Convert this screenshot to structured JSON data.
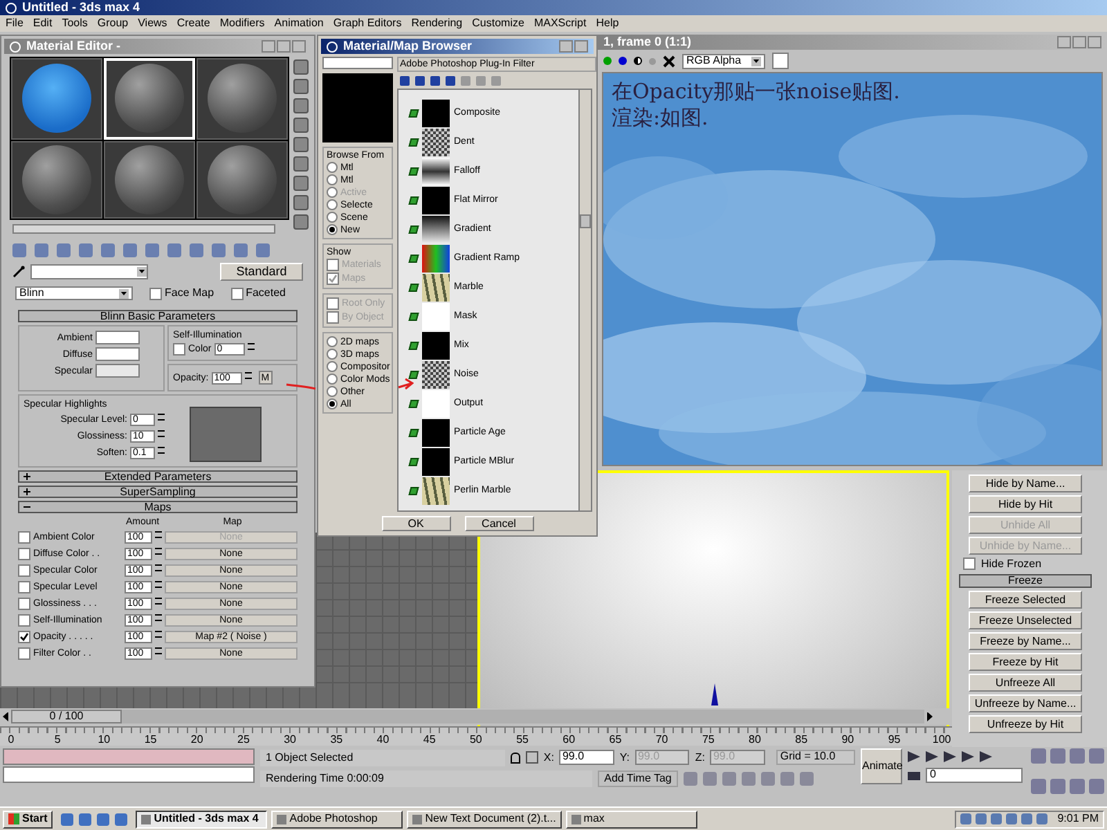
{
  "app": {
    "title": "Untitled - 3ds max 4",
    "menu": [
      "File",
      "Edit",
      "Tools",
      "Group",
      "Views",
      "Create",
      "Modifiers",
      "Animation",
      "Graph Editors",
      "Rendering",
      "Customize",
      "MAXScript",
      "Help"
    ]
  },
  "material_editor": {
    "title": "Material Editor -",
    "slots": [
      {
        "kind": "blue",
        "selected": false
      },
      {
        "kind": "gray",
        "selected": true
      },
      {
        "kind": "gray",
        "selected": false
      },
      {
        "kind": "gray",
        "selected": false
      },
      {
        "kind": "gray",
        "selected": false
      },
      {
        "kind": "gray",
        "selected": false
      }
    ],
    "type_button": "Standard",
    "shader": "Blinn",
    "options": [
      {
        "label": "Face Map",
        "checked": false
      },
      {
        "label": "Faceted",
        "checked": false
      }
    ],
    "basic_rollout": "Blinn Basic Parameters",
    "colors": [
      {
        "label": "Ambient",
        "kind": "white"
      },
      {
        "label": "Diffuse",
        "kind": "white"
      },
      {
        "label": "Specular",
        "kind": "light"
      }
    ],
    "self_illumination": {
      "title": "Self-Illumination",
      "label": "Color",
      "checked": false,
      "value": "0"
    },
    "opacity": {
      "label": "Opacity:",
      "value": "100",
      "button": "M"
    },
    "specular": {
      "title": "Specular Highlights",
      "fields": [
        {
          "label": "Specular Level:",
          "value": "0"
        },
        {
          "label": "Glossiness:",
          "value": "10"
        },
        {
          "label": "Soften:",
          "value": "0.1"
        }
      ]
    },
    "rollouts": [
      {
        "title": "Extended Parameters",
        "expanded": false
      },
      {
        "title": "SuperSampling",
        "expanded": false
      },
      {
        "title": "Maps",
        "expanded": true
      }
    ],
    "maps": {
      "columns": [
        "Amount",
        "Map"
      ],
      "rows": [
        {
          "label": "Ambient Color",
          "checked": false,
          "amount": "100",
          "map": "None",
          "disabled": true
        },
        {
          "label": "Diffuse Color . .",
          "checked": false,
          "amount": "100",
          "map": "None",
          "disabled": false
        },
        {
          "label": "Specular Color",
          "checked": false,
          "amount": "100",
          "map": "None",
          "disabled": false
        },
        {
          "label": "Specular Level",
          "checked": false,
          "amount": "100",
          "map": "None",
          "disabled": false
        },
        {
          "label": "Glossiness . . .",
          "checked": false,
          "amount": "100",
          "map": "None",
          "disabled": false
        },
        {
          "label": "Self-Illumination",
          "checked": false,
          "amount": "100",
          "map": "None",
          "disabled": false
        },
        {
          "label": "Opacity . . . . .",
          "checked": true,
          "amount": "100",
          "map": "Map #2  ( Noise )",
          "disabled": false
        },
        {
          "label": "Filter Color . .",
          "checked": false,
          "amount": "100",
          "map": "None",
          "disabled": false
        }
      ]
    }
  },
  "browser": {
    "title": "Material/Map Browser",
    "filter": "Adobe Photoshop Plug-In Filter",
    "browse_from": {
      "title": "Browse From",
      "options": [
        {
          "label": "Mtl",
          "selected": false,
          "disabled": false
        },
        {
          "label": "Mtl",
          "selected": false,
          "disabled": false
        },
        {
          "label": "Active",
          "selected": false,
          "disabled": true
        },
        {
          "label": "Selecte",
          "selected": false,
          "disabled": false
        },
        {
          "label": "Scene",
          "selected": false,
          "disabled": false
        },
        {
          "label": "New",
          "selected": true,
          "disabled": false
        }
      ]
    },
    "show": {
      "title": "Show",
      "options": [
        {
          "label": "Materials",
          "checked": false
        },
        {
          "label": "Maps",
          "checked": true
        }
      ]
    },
    "scope": [
      {
        "label": "Root Only",
        "checked": false
      },
      {
        "label": "By Object",
        "checked": false
      }
    ],
    "categories": [
      {
        "label": "2D maps",
        "selected": false
      },
      {
        "label": "3D maps",
        "selected": false
      },
      {
        "label": "Compositor",
        "selected": false
      },
      {
        "label": "Color Mods",
        "selected": false
      },
      {
        "label": "Other",
        "selected": false
      },
      {
        "label": "All",
        "selected": true
      }
    ],
    "maps": [
      {
        "name": "Composite",
        "kind": "black"
      },
      {
        "name": "Dent",
        "kind": "noise"
      },
      {
        "name": "Falloff",
        "kind": "falloff"
      },
      {
        "name": "Flat Mirror",
        "kind": "black"
      },
      {
        "name": "Gradient",
        "kind": "gradient"
      },
      {
        "name": "Gradient Ramp",
        "kind": "ramp"
      },
      {
        "name": "Marble",
        "kind": "marble"
      },
      {
        "name": "Mask",
        "kind": "white"
      },
      {
        "name": "Mix",
        "kind": "black"
      },
      {
        "name": "Noise",
        "kind": "noise"
      },
      {
        "name": "Output",
        "kind": "white"
      },
      {
        "name": "Particle Age",
        "kind": "black"
      },
      {
        "name": "Particle MBlur",
        "kind": "black"
      },
      {
        "name": "Perlin Marble",
        "kind": "marble"
      }
    ],
    "buttons": [
      "OK",
      "Cancel"
    ]
  },
  "render": {
    "title": "1, frame 0 (1:1)",
    "channel": "RGB Alpha",
    "note": [
      "在Opacity那贴一张noise贴图.",
      "渲染:如图."
    ]
  },
  "command_panel": [
    {
      "kind": "button",
      "label": "Hide by Name...",
      "disabled": false
    },
    {
      "kind": "button",
      "label": "Hide by Hit",
      "disabled": false
    },
    {
      "kind": "button",
      "label": "Unhide All",
      "disabled": true
    },
    {
      "kind": "button",
      "label": "Unhide by Name...",
      "disabled": true
    },
    {
      "kind": "checkbox",
      "label": "Hide Frozen",
      "checked": false
    },
    {
      "kind": "rollout",
      "label": "Freeze"
    },
    {
      "kind": "button",
      "label": "Freeze Selected",
      "disabled": false
    },
    {
      "kind": "button",
      "label": "Freeze Unselected",
      "disabled": false
    },
    {
      "kind": "button",
      "label": "Freeze by Name...",
      "disabled": false
    },
    {
      "kind": "button",
      "label": "Freeze by Hit",
      "disabled": false
    },
    {
      "kind": "button",
      "label": "Unfreeze All",
      "disabled": false
    },
    {
      "kind": "button",
      "label": "Unfreeze by Name...",
      "disabled": false
    },
    {
      "kind": "button",
      "label": "Unfreeze by Hit",
      "disabled": false
    }
  ],
  "timeline": {
    "position": "0 / 100",
    "level": 0,
    "ticks": [
      "0",
      "5",
      "10",
      "15",
      "20",
      "25",
      "30",
      "35",
      "40",
      "45",
      "50",
      "55",
      "60",
      "65",
      "70",
      "75",
      "80",
      "85",
      "90",
      "95",
      "100"
    ]
  },
  "status": {
    "selection": "1 Object Selected",
    "render_time": "Rendering Time  0:00:09",
    "coords": [
      {
        "label": "X:",
        "value": "99.0",
        "disabled": false
      },
      {
        "label": "Y:",
        "value": "99.0",
        "disabled": true
      },
      {
        "label": "Z:",
        "value": "99.0",
        "disabled": true
      }
    ],
    "grid": "Grid = 10.0",
    "time_tag": "Add Time Tag",
    "animate": "Animate",
    "frame": "0"
  },
  "taskbar": {
    "start": "Start",
    "tasks": [
      {
        "label": "Untitled - 3ds max 4",
        "selected": true
      },
      {
        "label": "Adobe Photoshop",
        "selected": false
      },
      {
        "label": "New Text Document (2).t...",
        "selected": false
      },
      {
        "label": "max",
        "selected": false
      }
    ],
    "clock": "9:01 PM"
  }
}
